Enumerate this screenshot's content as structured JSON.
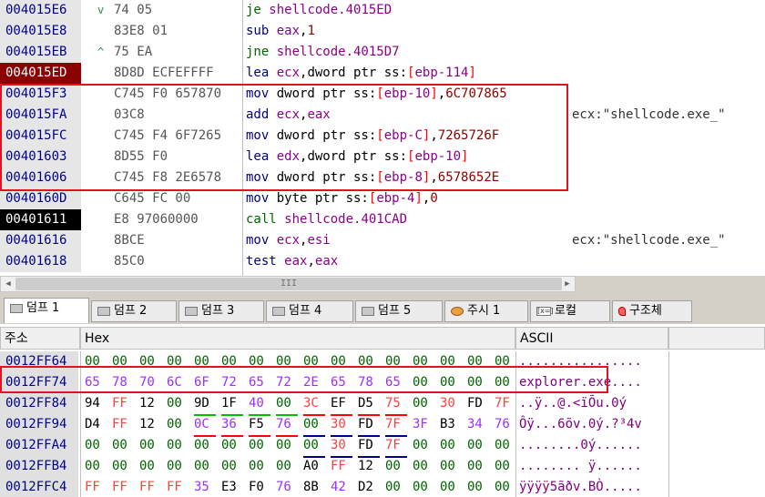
{
  "disasm": {
    "rows": [
      {
        "addr": "004015E6",
        "mark": "v",
        "bytes": "74 05",
        "instr": [
          [
            "opj",
            "je "
          ],
          [
            "sym",
            "shellcode.4015ED"
          ]
        ],
        "comment": ""
      },
      {
        "addr": "004015E8",
        "mark": "",
        "bytes": "83E8 01",
        "instr": [
          [
            "op",
            "sub "
          ],
          [
            "reg",
            "eax"
          ],
          [
            "plain",
            ","
          ],
          [
            "num",
            "1"
          ]
        ],
        "comment": ""
      },
      {
        "addr": "004015EB",
        "mark": "^",
        "bytes": "75 EA",
        "instr": [
          [
            "opj",
            "jne "
          ],
          [
            "sym",
            "shellcode.4015D7"
          ]
        ],
        "comment": ""
      },
      {
        "addr": "004015ED",
        "mark": "",
        "bytes": "8D8D ECFEFFFF",
        "instr": [
          [
            "op",
            "lea "
          ],
          [
            "reg",
            "ecx"
          ],
          [
            "plain",
            ",dword ptr ss:"
          ],
          [
            "brk",
            "["
          ],
          [
            "reg",
            "ebp-114"
          ],
          [
            "brk",
            "]"
          ]
        ],
        "comment": ""
      },
      {
        "addr": "004015F3",
        "mark": "",
        "bytes": "C745 F0 657870",
        "instr": [
          [
            "op",
            "mov "
          ],
          [
            "plain",
            "dword ptr ss:"
          ],
          [
            "brk",
            "["
          ],
          [
            "reg",
            "ebp-10"
          ],
          [
            "brk",
            "]"
          ],
          [
            "plain",
            ","
          ],
          [
            "num",
            "6C707865"
          ]
        ],
        "comment": ""
      },
      {
        "addr": "004015FA",
        "mark": "",
        "bytes": "03C8",
        "instr": [
          [
            "op",
            "add "
          ],
          [
            "reg",
            "ecx"
          ],
          [
            "plain",
            ","
          ],
          [
            "reg",
            "eax"
          ]
        ],
        "comment": "ecx:\"shellcode.exe_\""
      },
      {
        "addr": "004015FC",
        "mark": "",
        "bytes": "C745 F4 6F7265",
        "instr": [
          [
            "op",
            "mov "
          ],
          [
            "plain",
            "dword ptr ss:"
          ],
          [
            "brk",
            "["
          ],
          [
            "reg",
            "ebp-C"
          ],
          [
            "brk",
            "]"
          ],
          [
            "plain",
            ","
          ],
          [
            "num",
            "7265726F"
          ]
        ],
        "comment": ""
      },
      {
        "addr": "00401603",
        "mark": "",
        "bytes": "8D55 F0",
        "instr": [
          [
            "op",
            "lea "
          ],
          [
            "reg",
            "edx"
          ],
          [
            "plain",
            ",dword ptr ss:"
          ],
          [
            "brk",
            "["
          ],
          [
            "reg",
            "ebp-10"
          ],
          [
            "brk",
            "]"
          ]
        ],
        "comment": ""
      },
      {
        "addr": "00401606",
        "mark": "",
        "bytes": "C745 F8 2E6578",
        "instr": [
          [
            "op",
            "mov "
          ],
          [
            "plain",
            "dword ptr ss:"
          ],
          [
            "brk",
            "["
          ],
          [
            "reg",
            "ebp-8"
          ],
          [
            "brk",
            "]"
          ],
          [
            "plain",
            ","
          ],
          [
            "num",
            "6578652E"
          ]
        ],
        "comment": ""
      },
      {
        "addr": "0040160D",
        "mark": "",
        "bytes": "C645 FC 00",
        "instr": [
          [
            "op",
            "mov "
          ],
          [
            "plain",
            "byte ptr ss:"
          ],
          [
            "brk",
            "["
          ],
          [
            "reg",
            "ebp-4"
          ],
          [
            "brk",
            "]"
          ],
          [
            "plain",
            ","
          ],
          [
            "num",
            "0"
          ]
        ],
        "comment": ""
      },
      {
        "addr": "00401611",
        "mark": "",
        "bytes": "E8 97060000",
        "instr": [
          [
            "opc",
            "call "
          ],
          [
            "sym",
            "shellcode.401CAD"
          ]
        ],
        "comment": ""
      },
      {
        "addr": "00401616",
        "mark": "",
        "bytes": "8BCE",
        "instr": [
          [
            "op",
            "mov "
          ],
          [
            "reg",
            "ecx"
          ],
          [
            "plain",
            ","
          ],
          [
            "reg",
            "esi"
          ]
        ],
        "comment": "ecx:\"shellcode.exe_\""
      },
      {
        "addr": "00401618",
        "mark": "",
        "bytes": "85C0",
        "instr": [
          [
            "op",
            "test "
          ],
          [
            "reg",
            "eax"
          ],
          [
            "plain",
            ","
          ],
          [
            "reg",
            "eax"
          ]
        ],
        "comment": ""
      }
    ]
  },
  "scrollbar": {
    "thumb_label": "III"
  },
  "tabs": [
    {
      "label": "덤프 1",
      "icon": "memory-icon",
      "active": true
    },
    {
      "label": "덤프 2",
      "icon": "memory-icon",
      "active": false
    },
    {
      "label": "덤프 3",
      "icon": "memory-icon",
      "active": false
    },
    {
      "label": "덤프 4",
      "icon": "memory-icon",
      "active": false
    },
    {
      "label": "덤프 5",
      "icon": "memory-icon",
      "active": false
    },
    {
      "label": "주시 1",
      "icon": "watch-icon",
      "active": false
    },
    {
      "label": "로컬",
      "icon": "locals-icon",
      "active": false
    },
    {
      "label": "구조체",
      "icon": "struct-icon",
      "active": false
    }
  ],
  "locals_icon_text": "[x=]",
  "dump": {
    "headers": {
      "address": "주소",
      "hex": "Hex",
      "ascii": "ASCII"
    },
    "rows": [
      {
        "addr": "0012FF64",
        "bytes": [
          [
            "00",
            "z"
          ],
          [
            "00",
            "z"
          ],
          [
            "00",
            "z"
          ],
          [
            "00",
            "z"
          ],
          [
            "00",
            "z"
          ],
          [
            "00",
            "z"
          ],
          [
            "00",
            "z"
          ],
          [
            "00",
            "z"
          ],
          [
            "00",
            "z"
          ],
          [
            "00",
            "z"
          ],
          [
            "00",
            "z"
          ],
          [
            "00",
            "z"
          ],
          [
            "00",
            "z"
          ],
          [
            "00",
            "z"
          ],
          [
            "00",
            "z"
          ],
          [
            "00",
            "z"
          ]
        ],
        "ascii": "................"
      },
      {
        "addr": "0012FF74",
        "bytes": [
          [
            "65",
            "p"
          ],
          [
            "78",
            "p"
          ],
          [
            "70",
            "p"
          ],
          [
            "6C",
            "p"
          ],
          [
            "6F",
            "p"
          ],
          [
            "72",
            "p"
          ],
          [
            "65",
            "p"
          ],
          [
            "72",
            "p"
          ],
          [
            "2E",
            "p"
          ],
          [
            "65",
            "p"
          ],
          [
            "78",
            "p"
          ],
          [
            "65",
            "p"
          ],
          [
            "00",
            "z"
          ],
          [
            "00",
            "z"
          ],
          [
            "00",
            "z"
          ],
          [
            "00",
            "z"
          ]
        ],
        "ascii": "explorer.exe...."
      },
      {
        "addr": "0012FF84",
        "bytes": [
          [
            "94",
            "b"
          ],
          [
            "FF",
            "r"
          ],
          [
            "12",
            "b"
          ],
          [
            "00",
            "z"
          ],
          [
            "9D",
            "b",
            "g"
          ],
          [
            "1F",
            "b",
            "g"
          ],
          [
            "40",
            "p",
            "g"
          ],
          [
            "00",
            "z",
            "g"
          ],
          [
            "3C",
            "r",
            "r"
          ],
          [
            "EF",
            "b",
            "r"
          ],
          [
            "D5",
            "b",
            "r"
          ],
          [
            "75",
            "r",
            "r"
          ],
          [
            "00",
            "z"
          ],
          [
            "30",
            "r"
          ],
          [
            "FD",
            "b"
          ],
          [
            "7F",
            "r"
          ]
        ],
        "ascii": "..ÿ..@.<ïÕu.0ý"
      },
      {
        "addr": "0012FF94",
        "bytes": [
          [
            "D4",
            "b"
          ],
          [
            "FF",
            "r"
          ],
          [
            "12",
            "b"
          ],
          [
            "00",
            "z"
          ],
          [
            "0C",
            "p",
            "r"
          ],
          [
            "36",
            "p",
            "r"
          ],
          [
            "F5",
            "b",
            "r"
          ],
          [
            "76",
            "p",
            "r"
          ],
          [
            "00",
            "z",
            "b"
          ],
          [
            "30",
            "r",
            "b"
          ],
          [
            "FD",
            "b",
            "b"
          ],
          [
            "7F",
            "r",
            "b"
          ],
          [
            "3F",
            "p"
          ],
          [
            "B3",
            "b"
          ],
          [
            "34",
            "p"
          ],
          [
            "76",
            "p"
          ]
        ],
        "ascii": "Ôÿ...6õv.0ý.?³4v"
      },
      {
        "addr": "0012FFA4",
        "bytes": [
          [
            "00",
            "z"
          ],
          [
            "00",
            "z"
          ],
          [
            "00",
            "z"
          ],
          [
            "00",
            "z"
          ],
          [
            "00",
            "z"
          ],
          [
            "00",
            "z"
          ],
          [
            "00",
            "z"
          ],
          [
            "00",
            "z"
          ],
          [
            "00",
            "z",
            "b"
          ],
          [
            "30",
            "r",
            "b"
          ],
          [
            "FD",
            "b",
            "b"
          ],
          [
            "7F",
            "r",
            "b"
          ],
          [
            "00",
            "z"
          ],
          [
            "00",
            "z"
          ],
          [
            "00",
            "z"
          ],
          [
            "00",
            "z"
          ]
        ],
        "ascii": "........0ý......"
      },
      {
        "addr": "0012FFB4",
        "bytes": [
          [
            "00",
            "z"
          ],
          [
            "00",
            "z"
          ],
          [
            "00",
            "z"
          ],
          [
            "00",
            "z"
          ],
          [
            "00",
            "z"
          ],
          [
            "00",
            "z"
          ],
          [
            "00",
            "z"
          ],
          [
            "00",
            "z"
          ],
          [
            "A0",
            "b"
          ],
          [
            "FF",
            "r"
          ],
          [
            "12",
            "b"
          ],
          [
            "00",
            "z"
          ],
          [
            "00",
            "z"
          ],
          [
            "00",
            "z"
          ],
          [
            "00",
            "z"
          ],
          [
            "00",
            "z"
          ]
        ],
        "ascii": "........ ÿ......"
      },
      {
        "addr": "0012FFC4",
        "bytes": [
          [
            "FF",
            "r"
          ],
          [
            "FF",
            "r"
          ],
          [
            "FF",
            "r"
          ],
          [
            "FF",
            "r"
          ],
          [
            "35",
            "p",
            "r"
          ],
          [
            "E3",
            "b",
            "r"
          ],
          [
            "F0",
            "b",
            "r"
          ],
          [
            "76",
            "p",
            "r"
          ],
          [
            "8B",
            "b"
          ],
          [
            "42",
            "p"
          ],
          [
            "D2",
            "b"
          ],
          [
            "00",
            "z"
          ],
          [
            "00",
            "z"
          ],
          [
            "00",
            "z"
          ],
          [
            "00",
            "z"
          ],
          [
            "00",
            "z"
          ]
        ],
        "ascii": "ÿÿÿÿ5ãðv.BÒ....."
      }
    ]
  }
}
